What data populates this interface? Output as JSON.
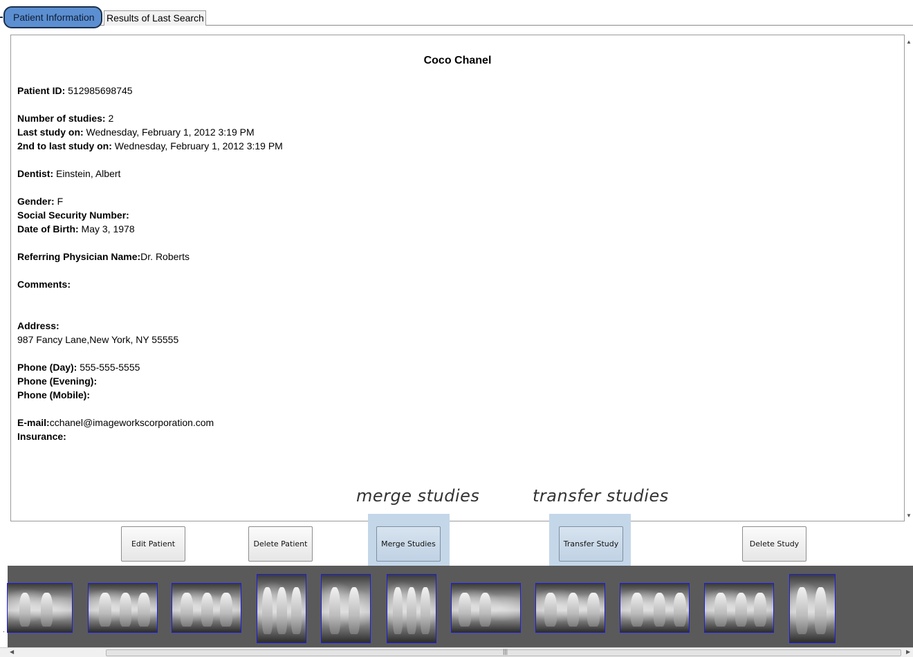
{
  "tabs": [
    {
      "label": "Patient Information"
    },
    {
      "label": "Results of Last Search"
    }
  ],
  "patient": {
    "name": "Coco Chanel",
    "fields": [
      {
        "label": "Patient ID:",
        "value": " 512985698745"
      },
      {
        "label": "Number of studies:",
        "value": " 2"
      },
      {
        "label": "Last study on:",
        "value": " Wednesday, February 1, 2012 3:19 PM"
      },
      {
        "label": "2nd to last study on:",
        "value": " Wednesday, February 1, 2012 3:19 PM"
      },
      {
        "label": "Dentist:",
        "value": " Einstein, Albert"
      },
      {
        "label": "Gender:",
        "value": " F"
      },
      {
        "label": "Social Security Number:",
        "value": ""
      },
      {
        "label": "Date of Birth:",
        "value": " May 3, 1978"
      },
      {
        "label": "Referring Physician Name:",
        "value": "Dr. Roberts"
      },
      {
        "label": "Comments:",
        "value": ""
      },
      {
        "label": "Address:",
        "value": ""
      },
      {
        "label": "",
        "value": "987 Fancy Lane,New York, NY 55555"
      },
      {
        "label": "Phone (Day):",
        "value": " 555-555-5555"
      },
      {
        "label": "Phone (Evening):",
        "value": ""
      },
      {
        "label": "Phone (Mobile):",
        "value": ""
      },
      {
        "label": "E-mail:",
        "value": "cchanel@imageworkscorporation.com"
      },
      {
        "label": "Insurance:",
        "value": ""
      }
    ]
  },
  "annotations": {
    "merge": "merge studies",
    "transfer": "transfer studies"
  },
  "buttons": {
    "edit": "Edit Patient",
    "delete_patient": "Delete Patient",
    "merge": "Merge Studies",
    "transfer": "Transfer Study",
    "delete_study": "Delete Study"
  },
  "thumbnails_count": 11,
  "colors": {
    "active_tab": "#5b8fd1",
    "highlight": "#c4d7e9",
    "thumb_border": "#1d1de0",
    "strip_bg": "#5a5a5a"
  },
  "icons": {
    "scroll_up": "arrow-up-icon",
    "scroll_down": "arrow-down-icon",
    "scroll_left": "arrow-left-icon",
    "scroll_right": "arrow-right-icon"
  }
}
